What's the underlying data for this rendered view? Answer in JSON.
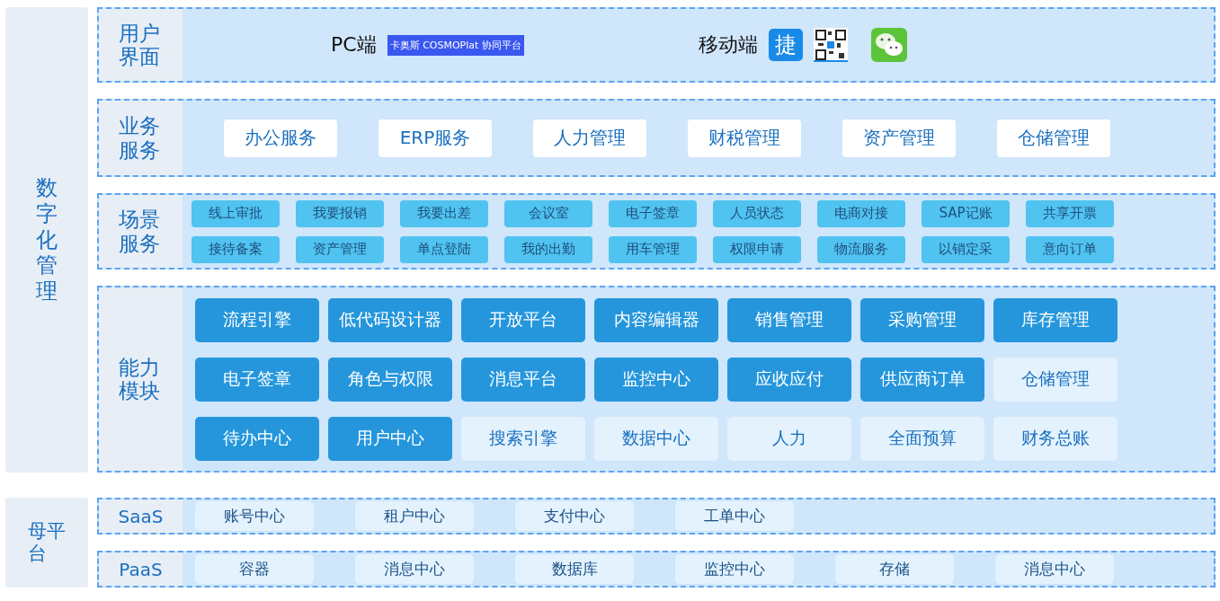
{
  "digital_management": {
    "title": "数字化管理",
    "user_interface": {
      "label": "用户界面",
      "pc_label": "PC端",
      "pc_logo": "卡奥斯 COSMOPlat 协同平台",
      "mobile_label": "移动端",
      "app_icon_char": "捷"
    },
    "business_services": {
      "label": "业务服务",
      "items": [
        "办公服务",
        "ERP服务",
        "人力管理",
        "财税管理",
        "资产管理",
        "仓储管理"
      ]
    },
    "scenario_services": {
      "label": "场景服务",
      "items": [
        "线上审批",
        "我要报销",
        "我要出差",
        "会议室",
        "电子签章",
        "人员状态",
        "电商对接",
        "SAP记账",
        "共享开票",
        "接待备案",
        "资产管理",
        "单点登陆",
        "我的出勤",
        "用车管理",
        "权限申请",
        "物流服务",
        "以销定采",
        "意向订单"
      ]
    },
    "capability_modules": {
      "label": "能力模块",
      "items": [
        {
          "text": "流程引擎",
          "kind": "dark"
        },
        {
          "text": "低代码设计器",
          "kind": "dark"
        },
        {
          "text": "开放平台",
          "kind": "dark"
        },
        {
          "text": "内容编辑器",
          "kind": "dark"
        },
        {
          "text": "销售管理",
          "kind": "dark"
        },
        {
          "text": "采购管理",
          "kind": "dark"
        },
        {
          "text": "库存管理",
          "kind": "dark"
        },
        {
          "text": "电子签章",
          "kind": "dark"
        },
        {
          "text": "角色与权限",
          "kind": "dark"
        },
        {
          "text": "消息平台",
          "kind": "dark"
        },
        {
          "text": "监控中心",
          "kind": "dark"
        },
        {
          "text": "应收应付",
          "kind": "dark"
        },
        {
          "text": "供应商订单",
          "kind": "dark"
        },
        {
          "text": "仓储管理",
          "kind": "light"
        },
        {
          "text": "待办中心",
          "kind": "dark"
        },
        {
          "text": "用户中心",
          "kind": "dark"
        },
        {
          "text": "搜索引擎",
          "kind": "light"
        },
        {
          "text": "数据中心",
          "kind": "light"
        },
        {
          "text": "人力",
          "kind": "light"
        },
        {
          "text": "全面预算",
          "kind": "light"
        },
        {
          "text": "财务总账",
          "kind": "light"
        }
      ]
    }
  },
  "parent_platform": {
    "title": "母平台",
    "layers": [
      {
        "label": "SaaS",
        "items": [
          "账号中心",
          "租户中心",
          "支付中心",
          "工单中心"
        ]
      },
      {
        "label": "PaaS",
        "items": [
          "容器",
          "消息中心",
          "数据库",
          "监控中心",
          "存储",
          "消息中心"
        ]
      }
    ]
  }
}
